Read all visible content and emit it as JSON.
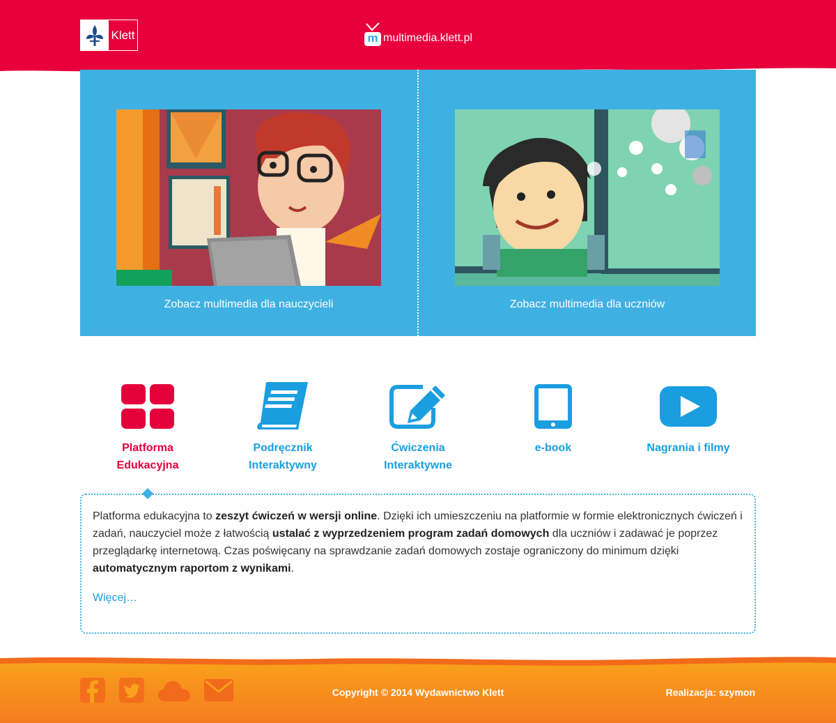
{
  "header": {
    "logo_text": "Klett",
    "site_icon_letter": "m",
    "site_name": "multimedia.klett.pl",
    "brand_color": "#e8003d"
  },
  "hero": {
    "background": "#3fb0e2",
    "teachers_caption": "Zobacz multimedia dla nauczycieli",
    "students_caption": "Zobacz multimedia dla uczniów",
    "teachers_image": "illustration-teacher-with-laptop",
    "students_image": "illustration-boy-at-window"
  },
  "features": [
    {
      "label_line1": "Platforma",
      "label_line2": "Edukacyjna",
      "icon": "grid-icon",
      "active": true
    },
    {
      "label_line1": "Podręcznik",
      "label_line2": "Interaktywny",
      "icon": "book-icon",
      "active": false
    },
    {
      "label_line1": "Ćwiczenia",
      "label_line2": "Interaktywne",
      "icon": "edit-icon",
      "active": false
    },
    {
      "label_line1": "e-book",
      "label_line2": "",
      "icon": "tablet-icon",
      "active": false
    },
    {
      "label_line1": "Nagrania i filmy",
      "label_line2": "",
      "icon": "play-icon",
      "active": false
    }
  ],
  "description": {
    "t1": "Platforma edukacyjna to ",
    "b1": "zeszyt ćwiczeń w wersji online",
    "t2": ". Dzięki ich umieszczeniu na platformie w formie elektronicznych ćwiczeń i zadań, nauczyciel może z łatwością ",
    "b2": "ustalać z wyprzedzeniem program zadań domowych",
    "t3": " dla uczniów i zadawać je poprzez przeglądarkę internetową. Czas poświęcany na sprawdzanie zadań domowych zostaje ograniczony do minimum dzięki ",
    "b3": "automatycznym raportom z wynikami",
    "t4": ".",
    "more_link": "Więcej…"
  },
  "footer": {
    "social_icons": [
      "facebook-icon",
      "twitter-icon",
      "cloud-icon",
      "mail-icon"
    ],
    "copyright": "Copyright © 2014 Wydawnictwo Klett",
    "credit": "Realizacja: szymon",
    "accent": "#f7941d"
  },
  "colors": {
    "accent_blue": "#1a9ee0",
    "accent_pink": "#e4003b"
  }
}
